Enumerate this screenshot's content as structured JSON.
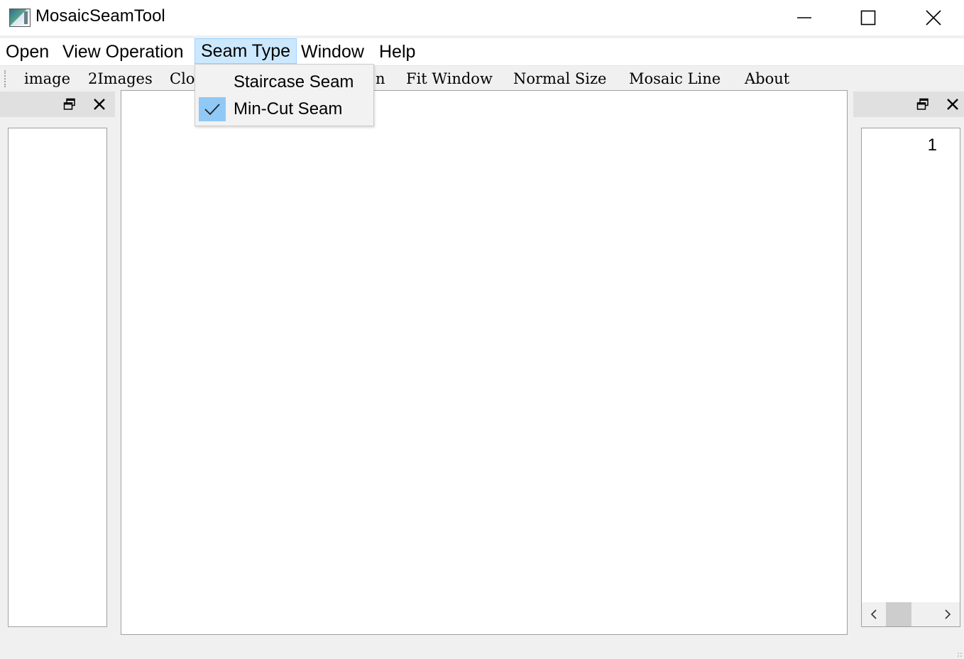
{
  "window": {
    "title": "MosaicSeamTool"
  },
  "menubar": {
    "items": [
      {
        "label": "Open"
      },
      {
        "label": "View Operation"
      },
      {
        "label": "Seam Type"
      },
      {
        "label": "Window"
      },
      {
        "label": "Help"
      }
    ],
    "active_item": "Seam Type"
  },
  "toolbar": {
    "items": [
      {
        "label": "image"
      },
      {
        "label": "2Images"
      },
      {
        "label": "Clo"
      },
      {
        "label": "n"
      },
      {
        "label": "Fit Window"
      },
      {
        "label": "Normal Size"
      },
      {
        "label": "Mosaic Line"
      },
      {
        "label": "About"
      }
    ]
  },
  "seam_menu": {
    "items": [
      {
        "label": "Staircase Seam",
        "checked": false
      },
      {
        "label": "Min-Cut Seam",
        "checked": true
      }
    ]
  },
  "right_panel": {
    "value": "1"
  },
  "icons": {
    "app": "app-icon",
    "minimize": "minimize-icon",
    "maximize": "maximize-icon",
    "close": "close-icon",
    "float": "float-icon",
    "dock_close": "dock-close-icon",
    "check": "check-icon",
    "scroll_left": "chevron-left-icon",
    "scroll_right": "chevron-right-icon"
  },
  "colors": {
    "menu_highlight": "#cce8ff",
    "check_highlight": "#90c8f6",
    "background": "#f0f0f0"
  }
}
